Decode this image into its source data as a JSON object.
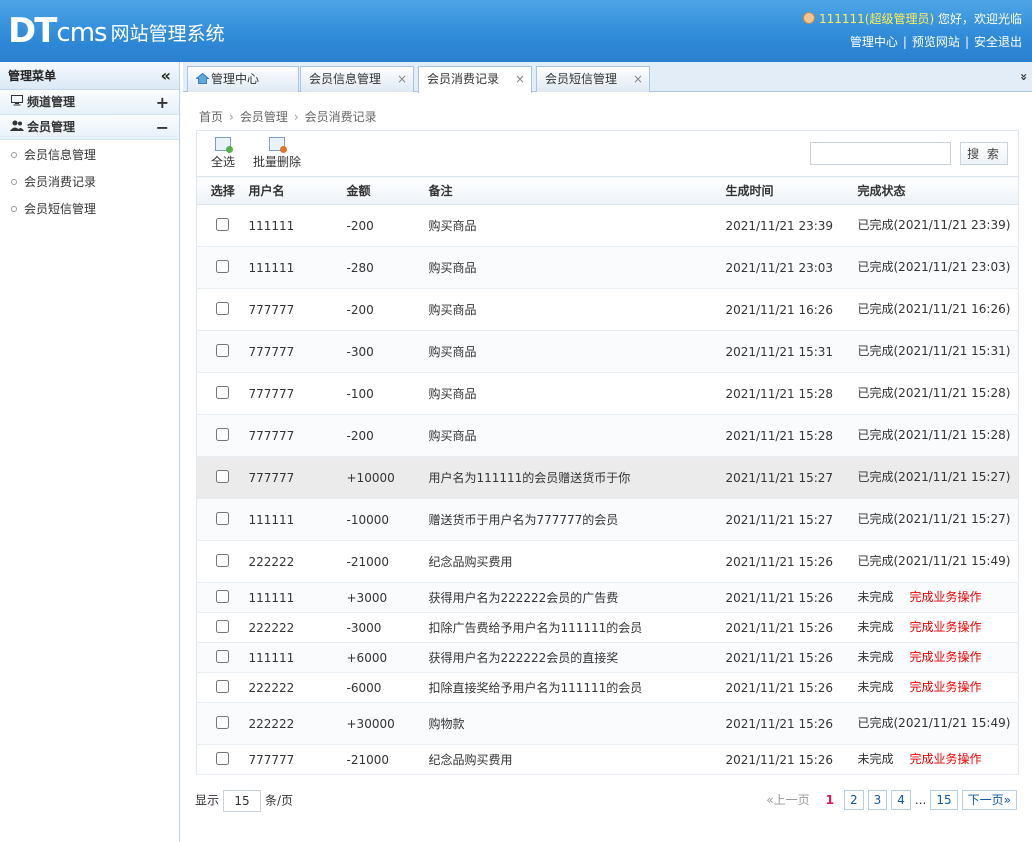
{
  "header": {
    "logo_dt": "DT",
    "logo_cms": "cms",
    "system_title": "网站管理系统",
    "username": "111111",
    "role": "(超级管理员)",
    "greeting": "您好，欢迎光临",
    "links": [
      "管理中心",
      "预览网站",
      "安全退出"
    ]
  },
  "sidebar": {
    "title": "管理菜单",
    "collapse_icon": "double-chevron-left-icon",
    "groups": [
      {
        "label": "频道管理",
        "icon": "monitor-icon",
        "toggle": "+"
      },
      {
        "label": "会员管理",
        "icon": "users-icon",
        "toggle": "−"
      }
    ],
    "items": [
      "会员信息管理",
      "会员消费记录",
      "会员短信管理"
    ]
  },
  "tabs": [
    {
      "label": "管理中心",
      "icon": "home-icon",
      "closable": false
    },
    {
      "label": "会员信息管理",
      "closable": true
    },
    {
      "label": "会员消费记录",
      "closable": true,
      "active": true
    },
    {
      "label": "会员短信管理",
      "closable": true
    }
  ],
  "tab_close_glyph": "×",
  "tab_more_glyph": "»",
  "breadcrumb": [
    "首页",
    "会员管理",
    "会员消费记录"
  ],
  "toolbar": {
    "select_all": "全选",
    "batch_delete": "批量删除",
    "search_placeholder": "",
    "search_button": "搜 索"
  },
  "table": {
    "headers": [
      "选择",
      "用户名",
      "金额",
      "备注",
      "生成时间",
      "完成状态"
    ],
    "rows": [
      {
        "user": "111111",
        "amount": "-200",
        "note": "购买商品",
        "time": "2021/11/21 23:39",
        "status": "已完成(2021/11/21 23:39)",
        "op": ""
      },
      {
        "user": "111111",
        "amount": "-280",
        "note": "购买商品",
        "time": "2021/11/21 23:03",
        "status": "已完成(2021/11/21 23:03)",
        "op": ""
      },
      {
        "user": "777777",
        "amount": "-200",
        "note": "购买商品",
        "time": "2021/11/21 16:26",
        "status": "已完成(2021/11/21 16:26)",
        "op": ""
      },
      {
        "user": "777777",
        "amount": "-300",
        "note": "购买商品",
        "time": "2021/11/21 15:31",
        "status": "已完成(2021/11/21 15:31)",
        "op": ""
      },
      {
        "user": "777777",
        "amount": "-100",
        "note": "购买商品",
        "time": "2021/11/21 15:28",
        "status": "已完成(2021/11/21 15:28)",
        "op": ""
      },
      {
        "user": "777777",
        "amount": "-200",
        "note": "购买商品",
        "time": "2021/11/21 15:28",
        "status": "已完成(2021/11/21 15:28)",
        "op": ""
      },
      {
        "user": "777777",
        "amount": "+10000",
        "note": "用户名为111111的会员赠送货币于你",
        "time": "2021/11/21 15:27",
        "status": "已完成(2021/11/21 15:27)",
        "op": ""
      },
      {
        "user": "111111",
        "amount": "-10000",
        "note": "赠送货币于用户名为777777的会员",
        "time": "2021/11/21 15:27",
        "status": "已完成(2021/11/21 15:27)",
        "op": ""
      },
      {
        "user": "222222",
        "amount": "-21000",
        "note": "纪念品购买费用",
        "time": "2021/11/21 15:26",
        "status": "已完成(2021/11/21 15:49)",
        "op": ""
      },
      {
        "user": "111111",
        "amount": "+3000",
        "note": "获得用户名为222222会员的广告费",
        "time": "2021/11/21 15:26",
        "status": "未完成",
        "op": "完成业务操作"
      },
      {
        "user": "222222",
        "amount": "-3000",
        "note": "扣除广告费给予用户名为111111的会员",
        "time": "2021/11/21 15:26",
        "status": "未完成",
        "op": "完成业务操作"
      },
      {
        "user": "111111",
        "amount": "+6000",
        "note": "获得用户名为222222会员的直接奖",
        "time": "2021/11/21 15:26",
        "status": "未完成",
        "op": "完成业务操作"
      },
      {
        "user": "222222",
        "amount": "-6000",
        "note": "扣除直接奖给予用户名为111111的会员",
        "time": "2021/11/21 15:26",
        "status": "未完成",
        "op": "完成业务操作"
      },
      {
        "user": "222222",
        "amount": "+30000",
        "note": "购物款",
        "time": "2021/11/21 15:26",
        "status": "已完成(2021/11/21 15:49)",
        "op": ""
      },
      {
        "user": "777777",
        "amount": "-21000",
        "note": "纪念品购买费用",
        "time": "2021/11/21 15:26",
        "status": "未完成",
        "op": "完成业务操作"
      }
    ]
  },
  "pager": {
    "show_label": "显示",
    "page_size": "15",
    "unit_label": "条/页",
    "prev": "«上一页",
    "pages": [
      "1",
      "2",
      "3",
      "4"
    ],
    "current": "1",
    "ellipsis": "...",
    "last": "15",
    "next": "下一页»"
  },
  "colors": {
    "header": "#2f8ad8",
    "username": "#ffee55",
    "op_link": "#e00",
    "current_page": "#e2155b"
  }
}
